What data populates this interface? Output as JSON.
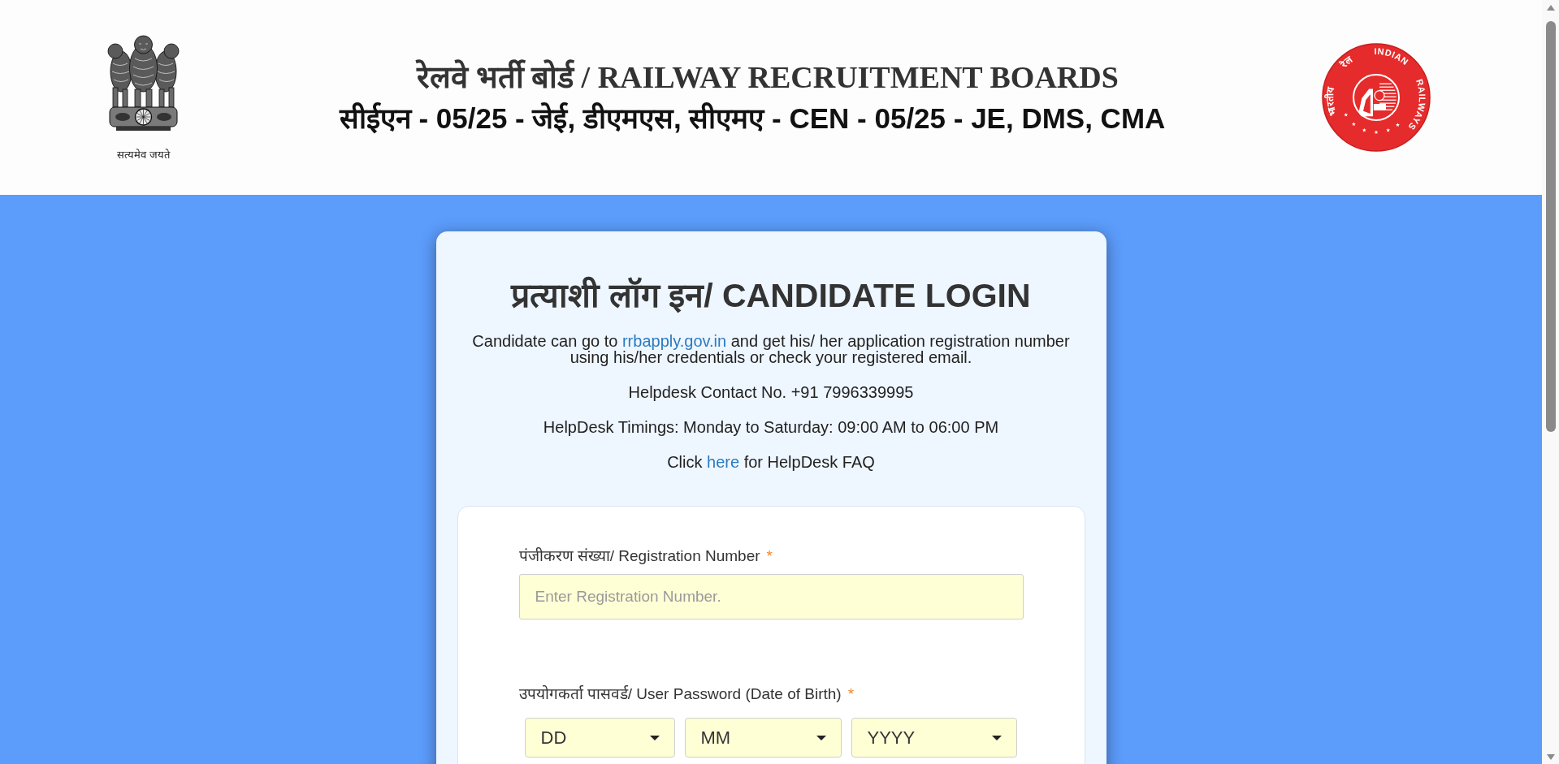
{
  "header": {
    "emblem_caption": "सत्यमेव जयते",
    "title": "रेलवे भर्ती बोर्ड / RAILWAY RECRUITMENT BOARDS",
    "subtitle": "सीईएन - 05/25 - जेई, डीएमएस, सीएमए - CEN - 05/25 - JE, DMS, CMA",
    "logo": {
      "english_words": [
        "INDIAN",
        "RAILWAYS"
      ],
      "hindi_words": [
        "भारतीय",
        "रेल"
      ]
    }
  },
  "login_card": {
    "title": "प्रत्याशी लॉग इन/ CANDIDATE LOGIN",
    "info": [
      {
        "kind": "link_text",
        "before": "Candidate can go to ",
        "link": "rrbapply.gov.in",
        "after": " and get his/ her application registration number using his/her credentials or check your registered email."
      },
      {
        "kind": "plain",
        "text": "Helpdesk Contact No. +91 7996339995"
      },
      {
        "kind": "plain",
        "text": "HelpDesk Timings: Monday to Saturday: 09:00 AM to 06:00 PM"
      },
      {
        "kind": "link_text",
        "before": "Click ",
        "link": "here",
        "after": " for HelpDesk FAQ"
      }
    ]
  },
  "form": {
    "fields": [
      {
        "kind": "text",
        "label": "पंजीकरण संख्या/ Registration Number",
        "required_mark": "*",
        "placeholder": "Enter Registration Number."
      },
      {
        "kind": "date",
        "label": "उपयोगकर्ता पासवर्ड/ User Password (Date of Birth)",
        "required_mark": "*",
        "selects": [
          {
            "value": "DD"
          },
          {
            "value": "MM"
          },
          {
            "value": "YYYY"
          }
        ]
      }
    ]
  }
}
